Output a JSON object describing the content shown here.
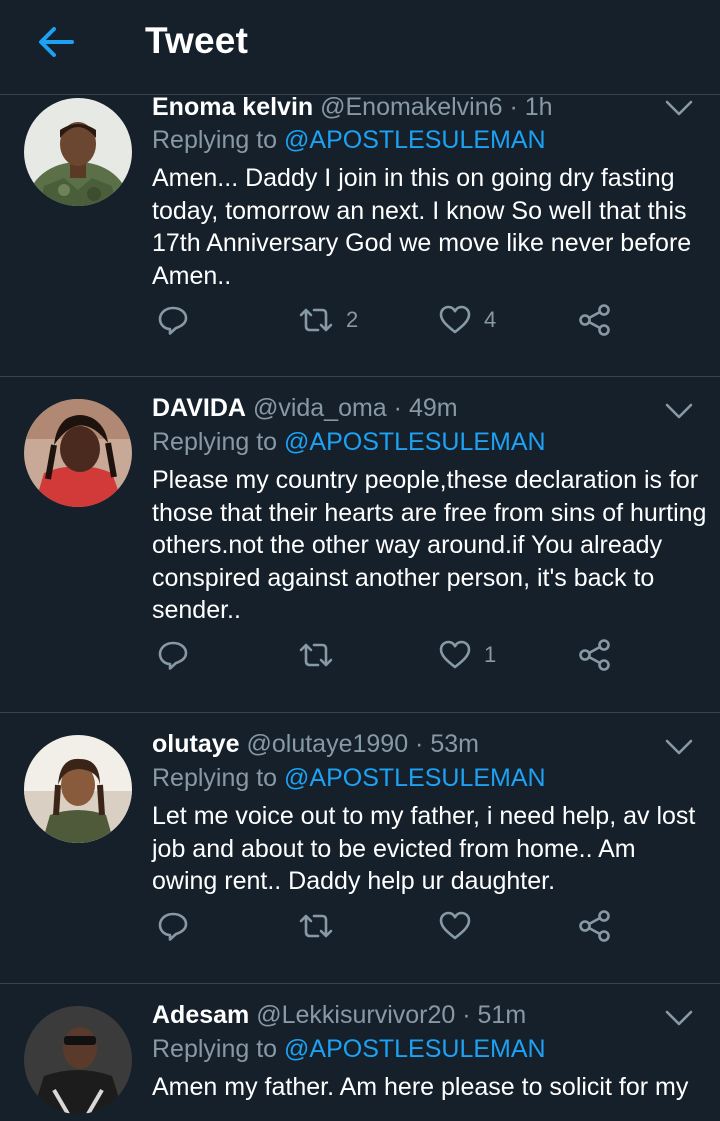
{
  "header": {
    "title": "Tweet"
  },
  "labels": {
    "replying_to": "Replying to"
  },
  "colors": {
    "background": "#15202b",
    "divider": "#38444d",
    "secondary_text": "#8899a6",
    "accent": "#1da1f2"
  },
  "tweets": [
    {
      "name": "Enoma kelvin",
      "handle": "@Enomakelvin6",
      "time": "1h",
      "mention": "@APOSTLESULEMAN",
      "text": "Amen... Daddy I join in this on going dry fasting today, tomorrow an next.  I know So well that this 17th Anniversary God we move like never before Amen..",
      "retweets": "2",
      "likes": "4"
    },
    {
      "name": "DAVIDA",
      "handle": "@vida_oma",
      "time": "49m",
      "mention": "@APOSTLESULEMAN",
      "text": "Please my country people,these declaration is for those that their hearts are free from sins of hurting others.not the other way around.if You already conspired against another person, it's back to sender..",
      "retweets": "",
      "likes": "1"
    },
    {
      "name": "olutaye",
      "handle": "@olutaye1990",
      "time": "53m",
      "mention": "@APOSTLESULEMAN",
      "text": "Let me voice out to my father, i need help, av lost job and about to be evicted from home.. Am owing rent.. Daddy help ur daughter.",
      "retweets": "",
      "likes": ""
    },
    {
      "name": "Adesam",
      "handle": "@Lekkisurvivor20",
      "time": "51m",
      "mention": "@APOSTLESULEMAN",
      "text": "Amen my father. Am here please to solicit for my",
      "retweets": "",
      "likes": ""
    }
  ]
}
